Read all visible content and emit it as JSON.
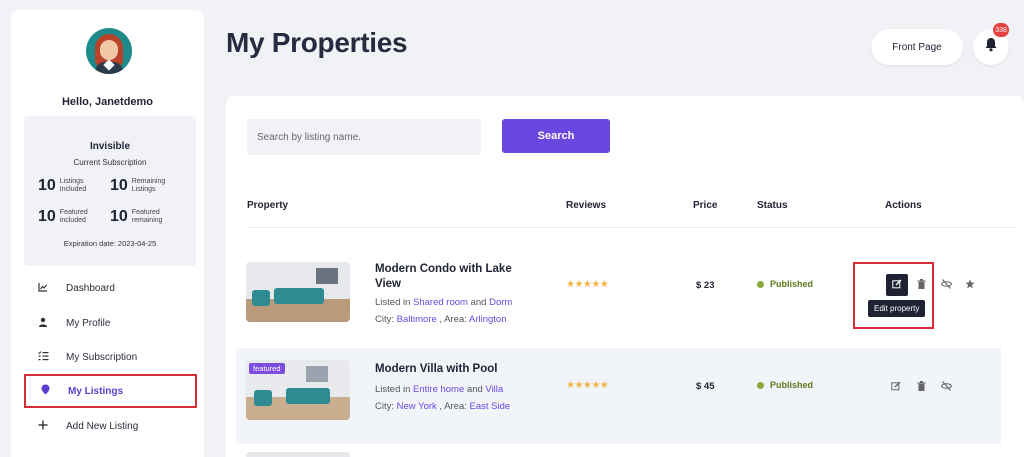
{
  "sidebar": {
    "greeting": "Hello, Janetdemo",
    "subscription": {
      "title": "Invisible",
      "subtitle": "Current Subscription",
      "stats": [
        {
          "num": "10",
          "label": "Listings Included"
        },
        {
          "num": "10",
          "label": "Remaining Listings"
        },
        {
          "num": "10",
          "label": "Featured included"
        },
        {
          "num": "10",
          "label": "Featured remaining"
        }
      ],
      "expiration": "Expiration date: 2023-04-25"
    },
    "nav": [
      {
        "label": "Dashboard",
        "icon": "chart-line-icon"
      },
      {
        "label": "My Profile",
        "icon": "user-icon"
      },
      {
        "label": "My Subscription",
        "icon": "list-check-icon"
      },
      {
        "label": "My Listings",
        "icon": "map-pin-icon",
        "active": true
      },
      {
        "label": "Add New Listing",
        "icon": "plus-icon"
      }
    ]
  },
  "header": {
    "title": "My Properties",
    "front_page_label": "Front Page",
    "notification_count": "338"
  },
  "search": {
    "placeholder": "Search by listing name.",
    "button_label": "Search"
  },
  "table": {
    "columns": [
      "Property",
      "Reviews",
      "Price",
      "Status",
      "Actions"
    ],
    "rows": [
      {
        "title": "Modern Condo with Lake View",
        "listed_prefix": "Listed in",
        "category": "Shared room",
        "and": "and",
        "type": "Dorm",
        "city_prefix": "City:",
        "city": "Baltimore",
        "area_prefix": ", Area:",
        "area": "Arlington",
        "stars": "★★★★★",
        "price": "$ 23",
        "status": "Published",
        "featured": false
      },
      {
        "title": "Modern Villa with Pool",
        "listed_prefix": "Listed in",
        "category": "Entire home",
        "and": "and",
        "type": "Villa",
        "city_prefix": "City:",
        "city": "New York",
        "area_prefix": ", Area:",
        "area": "East Side",
        "stars": "★★★★★",
        "price": "$ 45",
        "status": "Published",
        "featured": true,
        "featured_label": "featured"
      }
    ],
    "tooltip": "Edit property"
  },
  "colors": {
    "accent": "#6a48e0",
    "status_published": "#5a7a1c",
    "highlight": "#d62b35"
  }
}
